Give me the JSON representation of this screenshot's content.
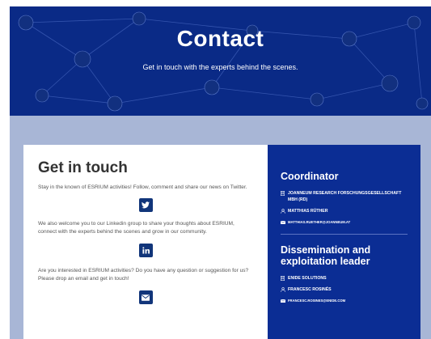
{
  "hero": {
    "title": "Contact",
    "subtitle": "Get in touch with the experts behind the scenes."
  },
  "get_in_touch": {
    "title": "Get in touch",
    "twitter_text": "Stay in the known of ESRIUM activities! Follow, comment and share our news on Twitter.",
    "linkedin_text": "We also welcome you to our Linkedin group to share your thoughts about ESRIUM, connect with the experts behind the scenes and grow in our community.",
    "email_text": "Are you interested in ESRIUM activities? Do you have any question or suggestion for us? Please drop an email and get in touch!"
  },
  "icons": {
    "twitter": "twitter-icon",
    "linkedin": "linkedin-icon",
    "email": "envelope-icon",
    "building": "building-icon",
    "person": "person-icon"
  },
  "coordinator": {
    "heading": "Coordinator",
    "organisation": "JOANNEUM RESEARCH FORSCHUNGSGESELLSCHAFT MBH (RD)",
    "person": "MATTHIAS RÜTHER",
    "email": "MATTHIAS.RUETHER@JOANNEUM.AT"
  },
  "dissemination": {
    "heading": "Dissemination and exploitation leader",
    "organisation": "ENIDE SOLUTIONS",
    "person": "FRANCESC ROSINÉS",
    "email": "FRANCESC.ROSINES@ENIDE.COM"
  },
  "colors": {
    "hero_bg": "#0a2a86",
    "band": "#a8b6d6",
    "panel_bg": "#0b2d94",
    "button_bg": "#11357a"
  }
}
